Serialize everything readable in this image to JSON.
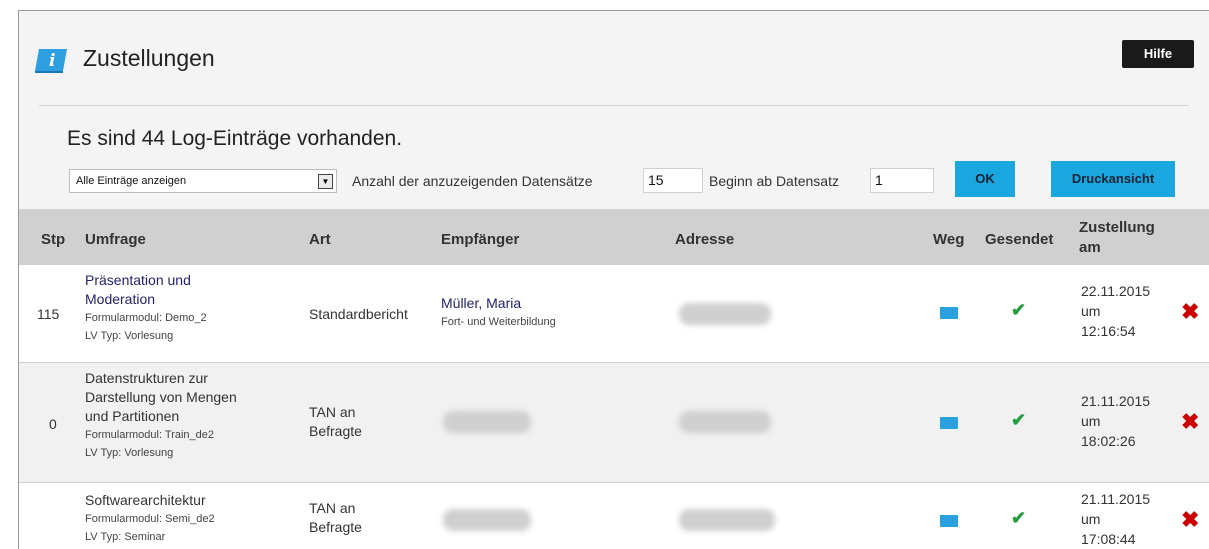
{
  "header": {
    "title": "Zustellungen",
    "help_label": "Hilfe"
  },
  "summary": "Es sind 44 Log-Einträge vorhanden.",
  "filters": {
    "filter_select_value": "Alle Einträge anzeigen",
    "count_label": "Anzahl der anzuzeigenden Datensätze",
    "count_value": "15",
    "start_label": "Beginn ab Datensatz",
    "start_value": "1",
    "ok_label": "OK",
    "print_label": "Druckansicht"
  },
  "table": {
    "columns": {
      "stp": "Stp",
      "umfrage": "Umfrage",
      "art": "Art",
      "empfaenger": "Empfänger",
      "adresse": "Adresse",
      "weg": "Weg",
      "gesendet": "Gesendet",
      "zustellung_line1": "Zustellung",
      "zustellung_line2": "am"
    },
    "rows": [
      {
        "stp": "115",
        "survey_line1": "Präsentation und",
        "survey_line2": "Moderation",
        "modul": "Formularmodul: Demo_2",
        "lv": "LV Typ: Vorlesung",
        "art": "Standardbericht",
        "recipient": "Müller, Maria",
        "recipient_sub": "Fort- und Weiterbildung",
        "date": "22.11.2015",
        "um": "um",
        "time": "12:16:54"
      },
      {
        "stp": "0",
        "survey_line1": "Datenstrukturen zur",
        "survey_line2": "Darstellung von Mengen",
        "survey_line3": "und Partitionen",
        "modul": "Formularmodul: Train_de2",
        "lv": "LV Typ: Vorlesung",
        "art_line1": "TAN an",
        "art_line2": "Befragte",
        "date": "21.11.2015",
        "um": "um",
        "time": "18:02:26"
      },
      {
        "survey_line1": "Softwarearchitektur",
        "modul": "Formularmodul: Semi_de2",
        "lv": "LV Typ: Seminar",
        "art_line1": "TAN an",
        "art_line2": "Befragte",
        "date": "21.11.2015",
        "um": "um",
        "time": "17:08:44"
      }
    ]
  },
  "icons": {
    "info": "info-book-icon",
    "weg": "envelope-icon",
    "gesendet": "checkmark-icon",
    "delete": "delete-x-icon"
  },
  "colors": {
    "accent_button": "#1aa7e0",
    "link": "#22236e",
    "check": "#22a040",
    "delete": "#cc0000"
  }
}
